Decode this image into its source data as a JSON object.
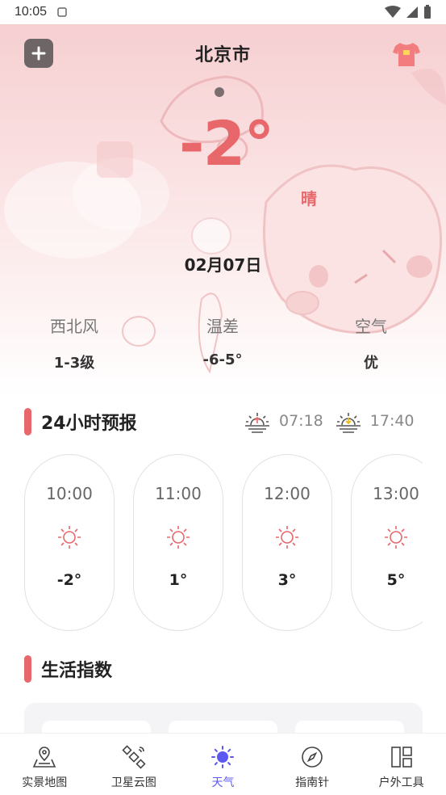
{
  "status": {
    "time": "10:05"
  },
  "header": {
    "city": "北京市"
  },
  "current": {
    "temperature": "-2°",
    "weather": "晴",
    "date": "02月07日"
  },
  "stats": [
    {
      "label": "西北风",
      "value": "1-3级"
    },
    {
      "label": "温差",
      "value": "-6-5°"
    },
    {
      "label": "空气",
      "value": "优"
    }
  ],
  "hourly_section": {
    "title": "24小时预报",
    "sunrise": "07:18",
    "sunset": "17:40"
  },
  "hourly": [
    {
      "time": "10:00",
      "icon": "sun-icon",
      "temp": "-2°"
    },
    {
      "time": "11:00",
      "icon": "sun-icon",
      "temp": "1°"
    },
    {
      "time": "12:00",
      "icon": "sun-icon",
      "temp": "3°"
    },
    {
      "time": "13:00",
      "icon": "sun-icon",
      "temp": "5°"
    }
  ],
  "life_section": {
    "title": "生活指数"
  },
  "nav": [
    {
      "label": "实景地图",
      "icon": "map-icon"
    },
    {
      "label": "卫星云图",
      "icon": "satellite-icon"
    },
    {
      "label": "天气",
      "icon": "weather-sun-icon"
    },
    {
      "label": "指南针",
      "icon": "compass-icon"
    },
    {
      "label": "户外工具",
      "icon": "tools-icon"
    }
  ],
  "colors": {
    "accent": "#e8676b",
    "nav_active": "#5b58f2"
  }
}
